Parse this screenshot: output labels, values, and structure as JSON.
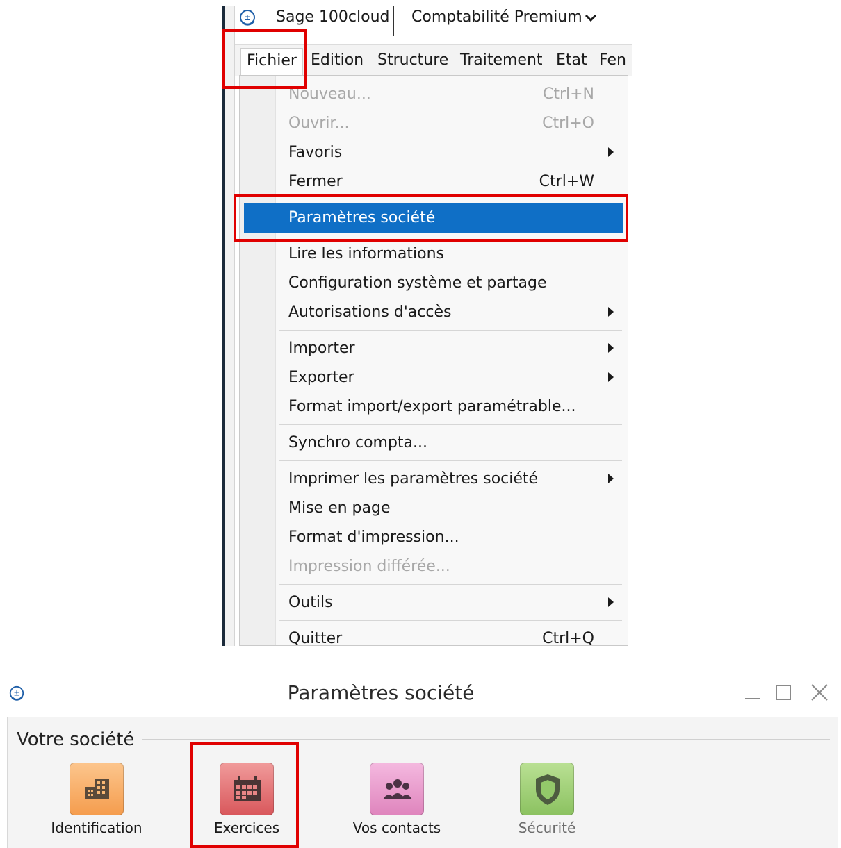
{
  "app": {
    "name": "Sage 100cloud",
    "product": "Comptabilité Premium"
  },
  "menubar": {
    "items": [
      "Fichier",
      "Edition",
      "Structure",
      "Traitement",
      "Etat",
      "Fen"
    ]
  },
  "file_menu": {
    "items": [
      {
        "label": "Nouveau...",
        "shortcut": "Ctrl+N",
        "disabled": true
      },
      {
        "label": "Ouvrir...",
        "shortcut": "Ctrl+O",
        "disabled": true
      },
      {
        "label": "Favoris",
        "submenu": true
      },
      {
        "label": "Fermer",
        "shortcut": "Ctrl+W"
      },
      {
        "label": "Paramètres société",
        "highlighted": true
      },
      {
        "label": "Lire les informations"
      },
      {
        "label": "Configuration système et partage"
      },
      {
        "label": "Autorisations d'accès",
        "submenu": true
      },
      {
        "label": "Importer",
        "submenu": true
      },
      {
        "label": "Exporter",
        "submenu": true
      },
      {
        "label": "Format import/export paramétrable..."
      },
      {
        "label": "Synchro compta..."
      },
      {
        "label": "Imprimer les paramètres société",
        "submenu": true
      },
      {
        "label": "Mise en page"
      },
      {
        "label": "Format d'impression..."
      },
      {
        "label": "Impression différée...",
        "disabled": true
      },
      {
        "label": "Outils",
        "submenu": true
      },
      {
        "label": "Quitter",
        "shortcut": "Ctrl+Q"
      }
    ]
  },
  "dialog": {
    "title": "Paramètres société",
    "section_title": "Votre société",
    "tiles": [
      {
        "label": "Identification",
        "icon": "building-icon",
        "color": "#f7a95c"
      },
      {
        "label": "Exercices",
        "icon": "calendar-icon",
        "color": "#e0686a"
      },
      {
        "label": "Vos contacts",
        "icon": "contacts-icon",
        "color": "#e692c6"
      },
      {
        "label": "Sécurité",
        "icon": "shield-icon",
        "color": "#9ccc72",
        "muted": true
      }
    ]
  },
  "colors": {
    "highlight": "#0f6fc6",
    "annotation": "#e00000"
  }
}
